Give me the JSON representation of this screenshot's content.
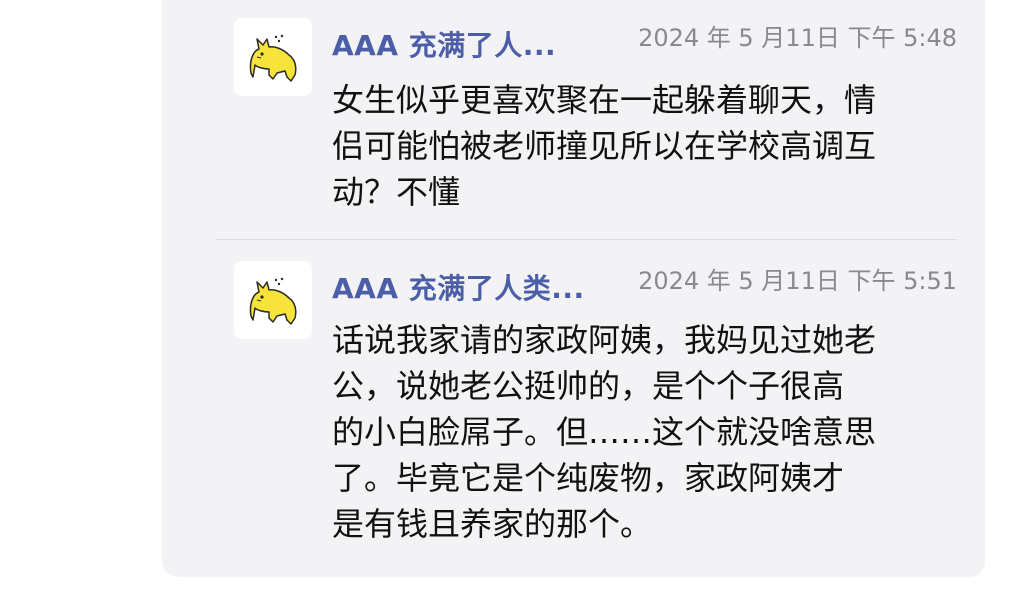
{
  "messages": [
    {
      "author": "AAA 充满了人...",
      "timestamp": "2024 年 5 月11日 下午 5:48",
      "avatar_icon": "yellow-cat-icon",
      "body_lines": [
        "女生似乎更喜欢聚在一起躲着聊天，情",
        "侣可能怕被老师撞见所以在学校高调互",
        "动？不懂"
      ]
    },
    {
      "author": "AAA 充满了人类...",
      "timestamp": "2024 年 5 月11日 下午 5:51",
      "avatar_icon": "yellow-cat-icon",
      "body_lines": [
        "话说我家请的家政阿姨，我妈见过她老",
        "公，说她老公挺帅的，是个个子很高",
        "的小白脸屌子。但……这个就没啥意思",
        "了。毕竟它是个纯废物，家政阿姨才",
        "是有钱且养家的那个。"
      ]
    }
  ],
  "colors": {
    "author": "#4d5ea8",
    "timestamp": "#8a8a8e",
    "panel_bg": "#f3f3f5",
    "cat_yellow": "#f7e43a"
  }
}
